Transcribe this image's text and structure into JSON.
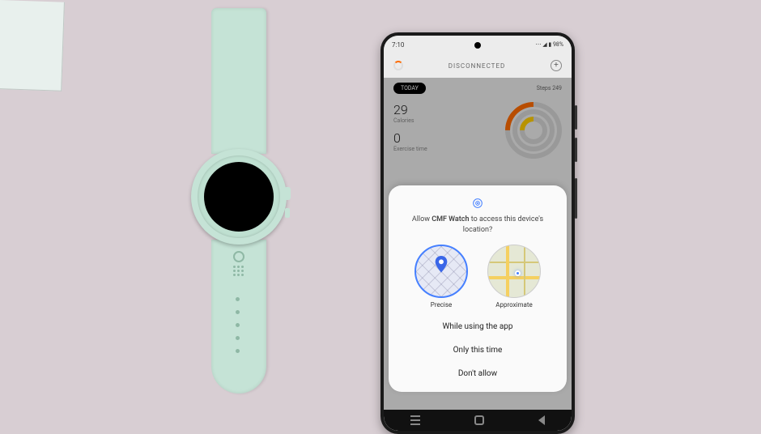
{
  "status_bar": {
    "time": "7:10",
    "left_icons": "◉ ▣",
    "right_text": "⋯ ◢ ▮ 98%"
  },
  "app": {
    "header_status": "DISCONNECTED",
    "today_chip": "TODAY",
    "steps_label": "Steps 249",
    "calories_value": "29",
    "calories_label": "Calories",
    "exercise_value": "0",
    "exercise_label": "Exercise time"
  },
  "permission": {
    "question_prefix": "Allow ",
    "app_name": "CMF Watch",
    "question_suffix": " to access this device's location?",
    "option_precise": "Precise",
    "option_approx": "Approximate",
    "action_while": "While using the app",
    "action_once": "Only this time",
    "action_deny": "Don't allow"
  }
}
